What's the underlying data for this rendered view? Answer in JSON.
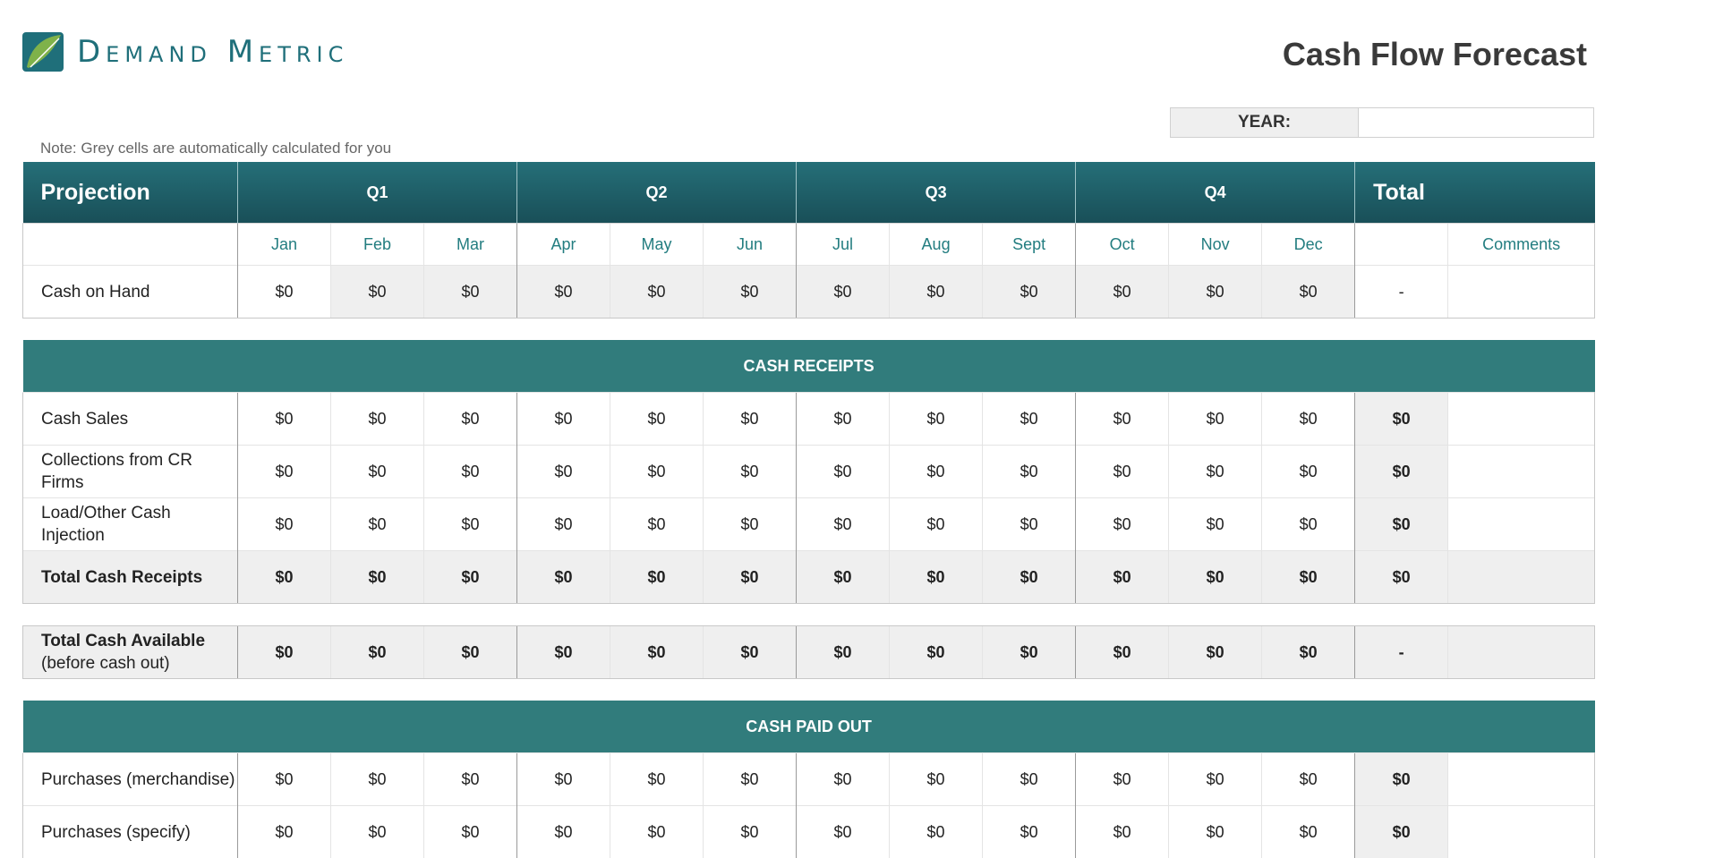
{
  "header": {
    "logo_text": "Demand Metric",
    "title": "Cash Flow Forecast",
    "year_label": "YEAR:",
    "year_value": "",
    "note": "Note: Grey cells are automatically calculated for you",
    "brand_color": "#1f6f7a"
  },
  "table": {
    "header": {
      "projection": "Projection",
      "quarters": [
        "Q1",
        "Q2",
        "Q3",
        "Q4"
      ],
      "total": "Total"
    },
    "months": [
      "Jan",
      "Feb",
      "Mar",
      "Apr",
      "May",
      "Jun",
      "Jul",
      "Aug",
      "Sept",
      "Oct",
      "Nov",
      "Dec"
    ],
    "comments_label": "Comments",
    "cash_on_hand": {
      "label": "Cash on Hand",
      "values": [
        "$0",
        "$0",
        "$0",
        "$0",
        "$0",
        "$0",
        "$0",
        "$0",
        "$0",
        "$0",
        "$0",
        "$0"
      ],
      "total": "-"
    },
    "receipts_section": "CASH RECEIPTS",
    "cash_sales": {
      "label": "Cash Sales",
      "values": [
        "$0",
        "$0",
        "$0",
        "$0",
        "$0",
        "$0",
        "$0",
        "$0",
        "$0",
        "$0",
        "$0",
        "$0"
      ],
      "total": "$0"
    },
    "collections": {
      "label": "Collections from CR Firms",
      "values": [
        "$0",
        "$0",
        "$0",
        "$0",
        "$0",
        "$0",
        "$0",
        "$0",
        "$0",
        "$0",
        "$0",
        "$0"
      ],
      "total": "$0"
    },
    "loan_other": {
      "label": "Load/Other Cash Injection",
      "values": [
        "$0",
        "$0",
        "$0",
        "$0",
        "$0",
        "$0",
        "$0",
        "$0",
        "$0",
        "$0",
        "$0",
        "$0"
      ],
      "total": "$0"
    },
    "total_receipts": {
      "label": "Total Cash Receipts",
      "values": [
        "$0",
        "$0",
        "$0",
        "$0",
        "$0",
        "$0",
        "$0",
        "$0",
        "$0",
        "$0",
        "$0",
        "$0"
      ],
      "total": "$0"
    },
    "total_available": {
      "label_line1": "Total Cash Available",
      "label_line2": "(before cash out)",
      "values": [
        "$0",
        "$0",
        "$0",
        "$0",
        "$0",
        "$0",
        "$0",
        "$0",
        "$0",
        "$0",
        "$0",
        "$0"
      ],
      "total": "-"
    },
    "paid_out_section": "CASH PAID OUT",
    "purchases_merch": {
      "label": "Purchases (merchandise)",
      "values": [
        "$0",
        "$0",
        "$0",
        "$0",
        "$0",
        "$0",
        "$0",
        "$0",
        "$0",
        "$0",
        "$0",
        "$0"
      ],
      "total": "$0"
    },
    "purchases_specify": {
      "label": "Purchases (specify)",
      "values": [
        "$0",
        "$0",
        "$0",
        "$0",
        "$0",
        "$0",
        "$0",
        "$0",
        "$0",
        "$0",
        "$0",
        "$0"
      ],
      "total": "$0"
    }
  }
}
